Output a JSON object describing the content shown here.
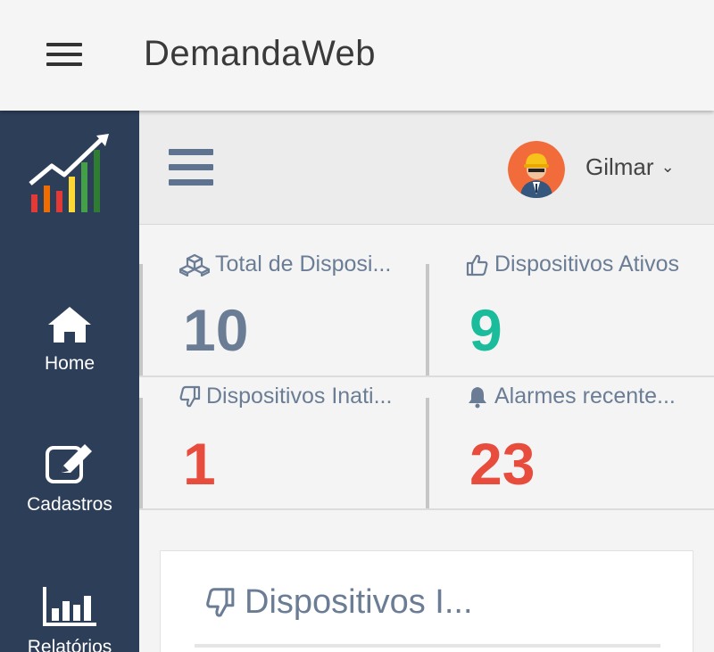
{
  "app": {
    "title": "DemandaWeb"
  },
  "user": {
    "name": "Gilmar"
  },
  "sidebar": {
    "items": [
      {
        "label": "Home",
        "icon": "home-icon"
      },
      {
        "label": "Cadastros",
        "icon": "edit-icon"
      },
      {
        "label": "Relatórios",
        "icon": "bar-chart-icon"
      }
    ]
  },
  "stats": [
    {
      "label": "Total de Disposi...",
      "value": "10",
      "icon": "cubes-icon",
      "color": "#6b7d95"
    },
    {
      "label": "Dispositivos Ativos",
      "value": "9",
      "icon": "thumbs-up-icon",
      "color": "#1abc9c"
    },
    {
      "label": "Dispositivos Inati...",
      "value": "1",
      "icon": "thumbs-down-icon",
      "color": "#e74c3c"
    },
    {
      "label": "Alarmes recente...",
      "value": "23",
      "icon": "bell-icon",
      "color": "#e74c3c"
    }
  ],
  "panel": {
    "title": "Dispositivos I...",
    "icon": "thumbs-down-icon"
  }
}
